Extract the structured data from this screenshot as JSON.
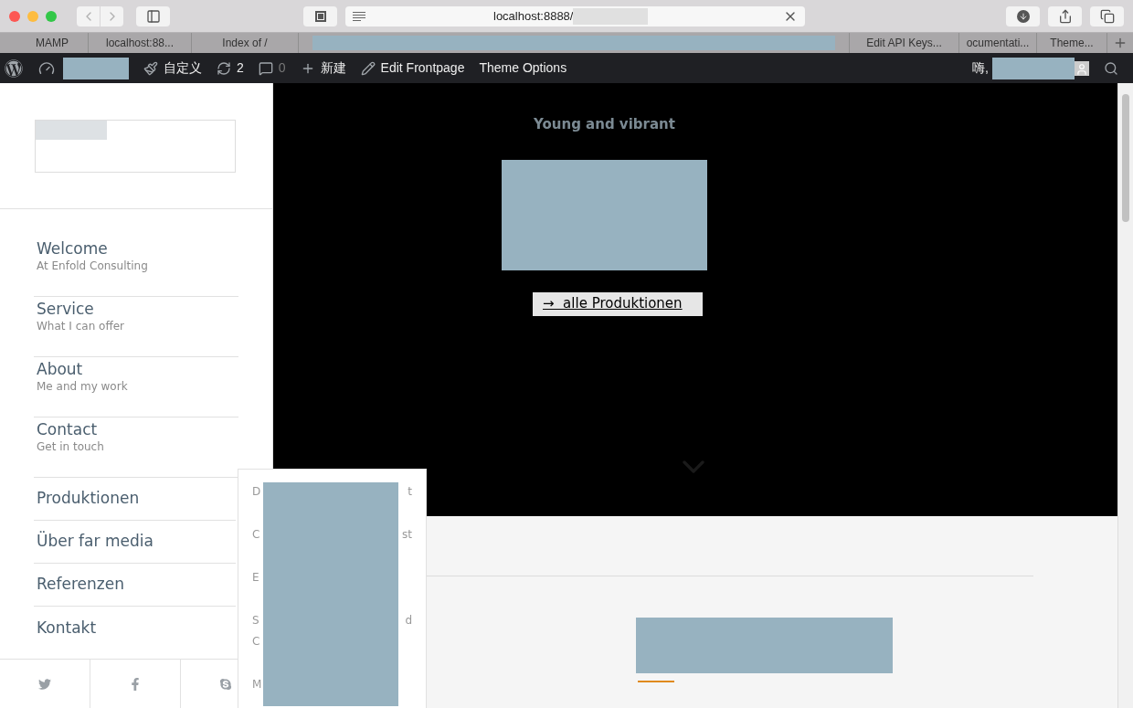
{
  "browser": {
    "address": "localhost:8888/",
    "tabs": [
      {
        "label": "MAMP"
      },
      {
        "label": "localhost:88..."
      },
      {
        "label": "Index of /"
      },
      {
        "label": "Edit API Keys..."
      },
      {
        "label": "ocumentati..."
      },
      {
        "label": "Theme..."
      }
    ]
  },
  "admin_bar": {
    "items": [
      {
        "kind": "customize",
        "label": "自定义"
      },
      {
        "kind": "updates",
        "label": "2"
      },
      {
        "kind": "comments",
        "label": "0"
      },
      {
        "kind": "new",
        "label": "新建"
      },
      {
        "kind": "edit",
        "label": "Edit Frontpage"
      },
      {
        "kind": "plain",
        "label": "Theme Options"
      }
    ],
    "greeting": "嗨,"
  },
  "sidebar": {
    "primary_menu": [
      {
        "title": "Welcome",
        "subtitle": "At Enfold Consulting"
      },
      {
        "title": "Service",
        "subtitle": "What I can offer"
      },
      {
        "title": "About",
        "subtitle": "Me and my work"
      },
      {
        "title": "Contact",
        "subtitle": "Get in touch"
      }
    ],
    "secondary_menu": [
      "Produktionen",
      "Über far media",
      "Referenzen",
      "Kontakt"
    ],
    "social": [
      {
        "kind": "twitter"
      },
      {
        "kind": "facebook"
      },
      {
        "kind": "skype"
      }
    ]
  },
  "submenu": [
    {
      "lines": [
        {
          "left": "D",
          "right": "t"
        }
      ]
    },
    {
      "lines": [
        {
          "left": "C",
          "right": "st"
        }
      ]
    },
    {
      "lines": [
        {
          "left": "E"
        }
      ]
    },
    {
      "lines": [
        {
          "left": "S",
          "right": "d"
        },
        {
          "left": "C"
        }
      ]
    },
    {
      "lines": [
        {
          "left": "M"
        }
      ]
    }
  ],
  "hero": {
    "tagline": "Young and vibrant",
    "button": "→  alle Produktionen"
  }
}
